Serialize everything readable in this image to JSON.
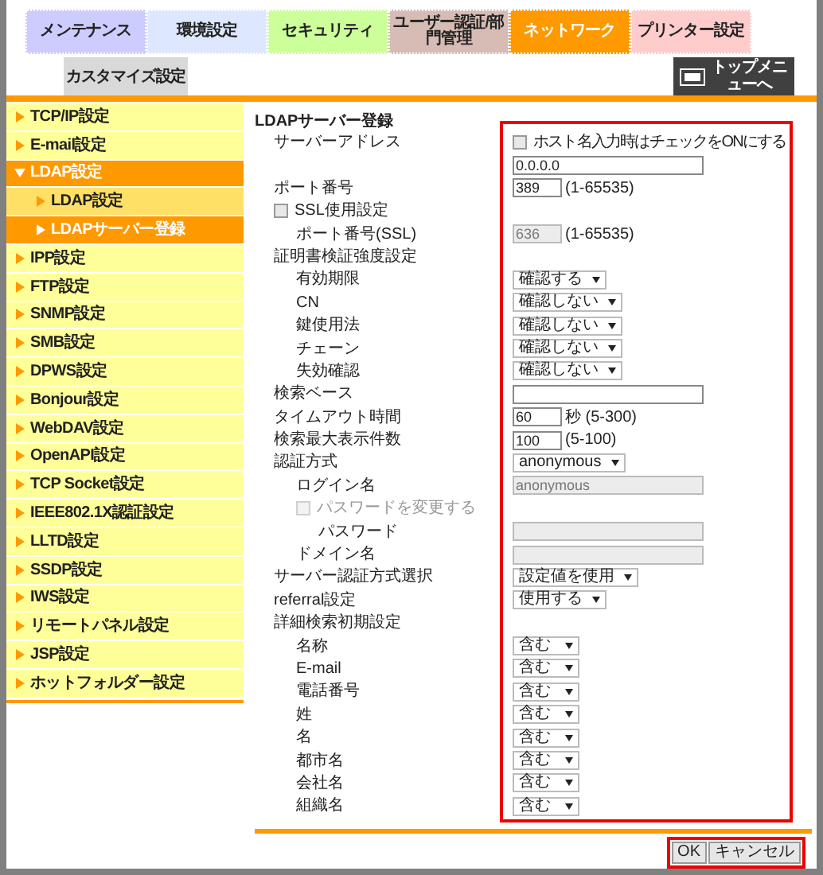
{
  "tabs": [
    {
      "label": "メンテナンス",
      "color": "#ccccff",
      "selected": false
    },
    {
      "label": "環境設定",
      "color": "#dde8ff",
      "selected": false
    },
    {
      "label": "セキュリティ",
      "color": "#ccff99",
      "selected": false
    },
    {
      "label": "ユーザー認証/部門管理",
      "color": "#d6bcb4",
      "selected": false
    },
    {
      "label": "ネットワーク",
      "color": "#ff9900",
      "selected": true
    },
    {
      "label": "プリンター設定",
      "color": "#ffcccc",
      "selected": false
    }
  ],
  "subtabs": [
    {
      "label": "カスタマイズ設定"
    }
  ],
  "top_menu_button": {
    "label": "トップメニューへ"
  },
  "sidebar": {
    "items": [
      {
        "label": "TCP/IP設定",
        "selected": false
      },
      {
        "label": "E-mail設定",
        "selected": false
      },
      {
        "label": "LDAP設定",
        "selected": true,
        "expanded": true,
        "children": [
          {
            "label": "LDAP設定",
            "selected": false
          },
          {
            "label": "LDAPサーバー登録",
            "selected": true
          }
        ]
      },
      {
        "label": "IPP設定",
        "selected": false
      },
      {
        "label": "FTP設定",
        "selected": false
      },
      {
        "label": "SNMP設定",
        "selected": false
      },
      {
        "label": "SMB設定",
        "selected": false
      },
      {
        "label": "DPWS設定",
        "selected": false
      },
      {
        "label": "Bonjour設定",
        "selected": false
      },
      {
        "label": "WebDAV設定",
        "selected": false
      },
      {
        "label": "OpenAPI設定",
        "selected": false
      },
      {
        "label": "TCP Socket設定",
        "selected": false
      },
      {
        "label": "IEEE802.1X認証設定",
        "selected": false
      },
      {
        "label": "LLTD設定",
        "selected": false
      },
      {
        "label": "SSDP設定",
        "selected": false
      },
      {
        "label": "IWS設定",
        "selected": false
      },
      {
        "label": "リモートパネル設定",
        "selected": false
      },
      {
        "label": "JSP設定",
        "selected": false
      },
      {
        "label": "ホットフォルダー設定",
        "selected": false
      }
    ]
  },
  "form": {
    "title": "LDAPサーバー登録",
    "highlighted": true,
    "rows": [
      {
        "label": "サーバーアドレス",
        "control": {
          "kind": "checkbox",
          "label": "ホスト名入力時はチェックをONにする",
          "checked": false
        }
      },
      {
        "control": {
          "kind": "text",
          "value": "0.0.0.0",
          "disabled": false
        }
      },
      {
        "label": "ポート番号",
        "control": {
          "kind": "number",
          "value": "389",
          "suffix": "(1-65535)",
          "disabled": false
        }
      },
      {
        "label": "SSL使用設定",
        "kind": "checkbox",
        "checked": false,
        "disabled": false,
        "children": [
          {
            "label": "ポート番号(SSL)",
            "control": {
              "kind": "number",
              "value": "636",
              "suffix": "(1-65535)",
              "disabled": true
            }
          }
        ]
      },
      {
        "label": "証明書検証強度設定",
        "children": [
          {
            "label": "有効期限",
            "control": {
              "kind": "select",
              "value": "確認する"
            }
          },
          {
            "label": "CN",
            "control": {
              "kind": "select",
              "value": "確認しない"
            }
          },
          {
            "label": "鍵使用法",
            "control": {
              "kind": "select",
              "value": "確認しない"
            }
          },
          {
            "label": "チェーン",
            "control": {
              "kind": "select",
              "value": "確認しない"
            }
          },
          {
            "label": "失効確認",
            "control": {
              "kind": "select",
              "value": "確認しない"
            }
          }
        ]
      },
      {
        "label": "検索ベース",
        "control": {
          "kind": "text",
          "disabled": false
        }
      },
      {
        "label": "タイムアウト時間",
        "control": {
          "kind": "number",
          "value": "60",
          "suffix": "秒 (5-300)",
          "disabled": false
        }
      },
      {
        "label": "検索最大表示件数",
        "control": {
          "kind": "number",
          "value": "100",
          "suffix": "(5-100)",
          "disabled": false
        }
      },
      {
        "label": "認証方式",
        "control": {
          "kind": "select",
          "value": "anonymous"
        },
        "children": [
          {
            "label": "ログイン名",
            "control": {
              "kind": "text",
              "value": "anonymous",
              "disabled": true
            }
          },
          {
            "label": "パスワードを変更する",
            "kind": "checkbox",
            "checked": false,
            "disabled": true,
            "children": [
              {
                "label": "パスワード",
                "control": {
                  "kind": "text",
                  "disabled": true
                }
              }
            ]
          },
          {
            "label": "ドメイン名",
            "control": {
              "kind": "text",
              "disabled": true
            }
          }
        ]
      },
      {
        "label": "サーバー認証方式選択",
        "control": {
          "kind": "select",
          "value": "設定値を使用"
        }
      },
      {
        "label": "referral設定",
        "control": {
          "kind": "select",
          "value": "使用する"
        }
      },
      {
        "label": "詳細検索初期設定",
        "children": [
          {
            "label": "名称",
            "control": {
              "kind": "select",
              "value": "含む"
            }
          },
          {
            "label": "E-mail",
            "control": {
              "kind": "select",
              "value": "含む"
            }
          },
          {
            "label": "電話番号",
            "control": {
              "kind": "select",
              "value": "含む"
            }
          },
          {
            "label": "姓",
            "control": {
              "kind": "select",
              "value": "含む"
            }
          },
          {
            "label": "名",
            "control": {
              "kind": "select",
              "value": "含む"
            }
          },
          {
            "label": "都市名",
            "control": {
              "kind": "select",
              "value": "含む"
            }
          },
          {
            "label": "会社名",
            "control": {
              "kind": "select",
              "value": "含む"
            }
          },
          {
            "label": "組織名",
            "control": {
              "kind": "select",
              "value": "含む"
            }
          }
        ]
      }
    ]
  },
  "buttons": {
    "highlighted": true,
    "items": [
      {
        "label": "OK"
      },
      {
        "label": "キャンセル"
      }
    ]
  }
}
